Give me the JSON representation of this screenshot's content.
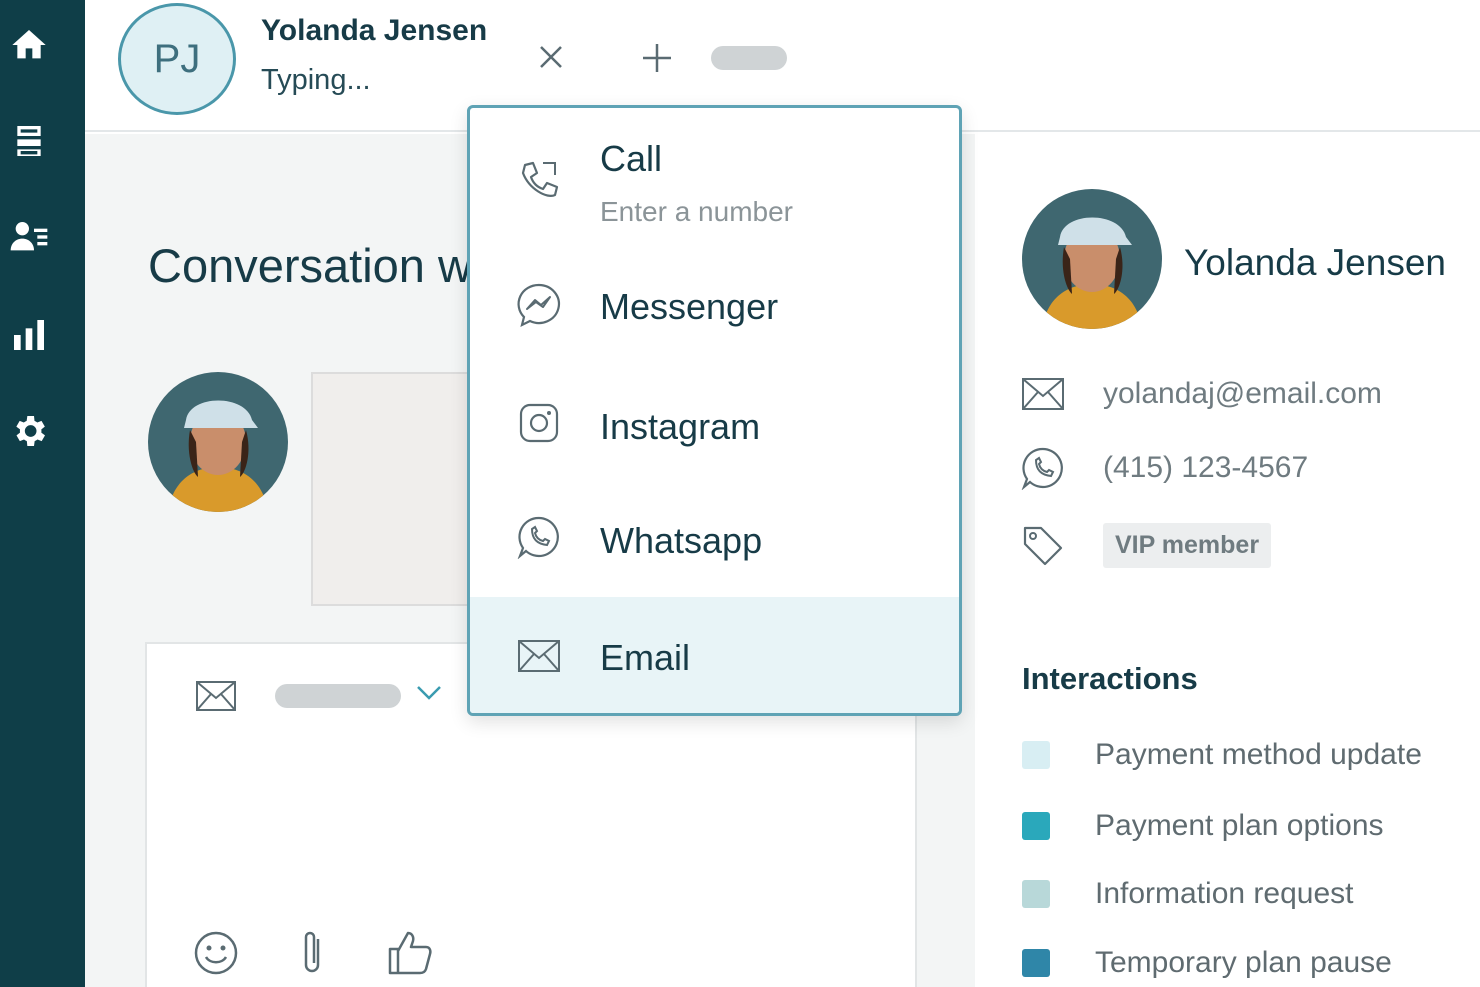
{
  "header": {
    "initials": "PJ",
    "name": "Yolanda Jensen",
    "status": "Typing..."
  },
  "main": {
    "title": "Conversation w"
  },
  "dropdown": {
    "items": [
      {
        "label": "Call",
        "sub": "Enter a number",
        "icon": "phone-icon"
      },
      {
        "label": "Messenger",
        "icon": "messenger-icon"
      },
      {
        "label": "Instagram",
        "icon": "instagram-icon"
      },
      {
        "label": "Whatsapp",
        "icon": "whatsapp-icon"
      },
      {
        "label": "Email",
        "icon": "mail-icon"
      }
    ]
  },
  "profile": {
    "name": "Yolanda Jensen",
    "email": "yolandaj@email.com",
    "phone": "(415) 123-4567",
    "tag": "VIP member"
  },
  "interactions": {
    "title": "Interactions",
    "items": [
      {
        "label": "Payment method update",
        "color": "#d8eef3"
      },
      {
        "label": "Payment plan options",
        "color": "#2aa8bb"
      },
      {
        "label": "Information request",
        "color": "#b8d8d9"
      },
      {
        "label": "Temporary plan pause",
        "color": "#2f86a8"
      }
    ]
  },
  "colors": {
    "sidebar": "#0f3e48",
    "accent": "#5fa3b5",
    "text": "#173b47"
  }
}
